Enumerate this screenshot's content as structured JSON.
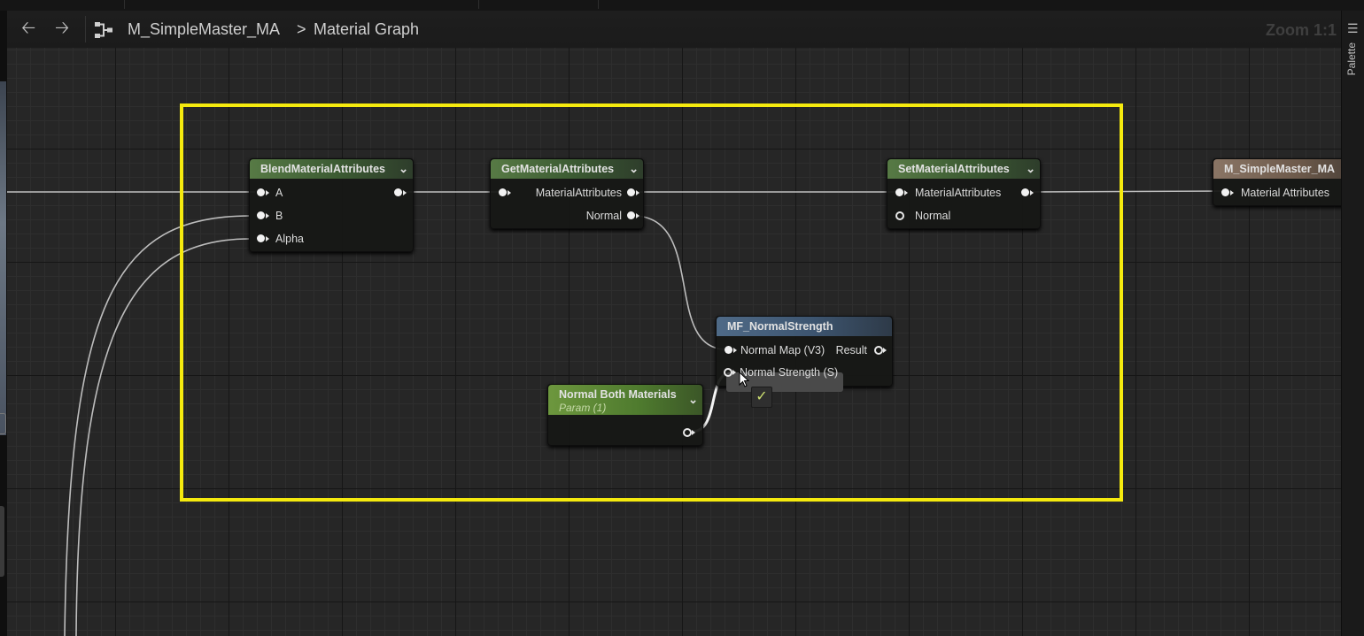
{
  "toolbar": {
    "back_icon": "back-arrow-icon",
    "forward_icon": "forward-arrow-icon",
    "graph_icon": "material-graph-icon",
    "breadcrumb_asset": "M_SimpleMaster_MA",
    "breadcrumb_separator": ">",
    "breadcrumb_graph": "Material Graph",
    "zoom": "Zoom 1:1"
  },
  "sidebar": {
    "palette_label": "Palette"
  },
  "nodes": {
    "blend": {
      "title": "BlendMaterialAttributes",
      "pins": [
        "A",
        "B",
        "Alpha"
      ]
    },
    "get": {
      "title": "GetMaterialAttributes",
      "pins": [
        "MaterialAttributes",
        "Normal"
      ]
    },
    "set": {
      "title": "SetMaterialAttributes",
      "pins": [
        "MaterialAttributes",
        "Normal"
      ]
    },
    "output": {
      "title": "M_SimpleMaster_MA",
      "pins": [
        "Material Attributes"
      ]
    },
    "normal_strength": {
      "title": "MF_NormalStrength",
      "inputs": [
        "Normal Map (V3)",
        "Normal Strength (S)"
      ],
      "output": "Result"
    },
    "param": {
      "title": "Normal Both Materials",
      "subtitle": "Param (1)"
    }
  },
  "colors": {
    "selection": "#f5ea0e",
    "background": "#262626",
    "node_body": "#161715",
    "function_header": "#4f6a87",
    "param_header": "#6d973e"
  }
}
